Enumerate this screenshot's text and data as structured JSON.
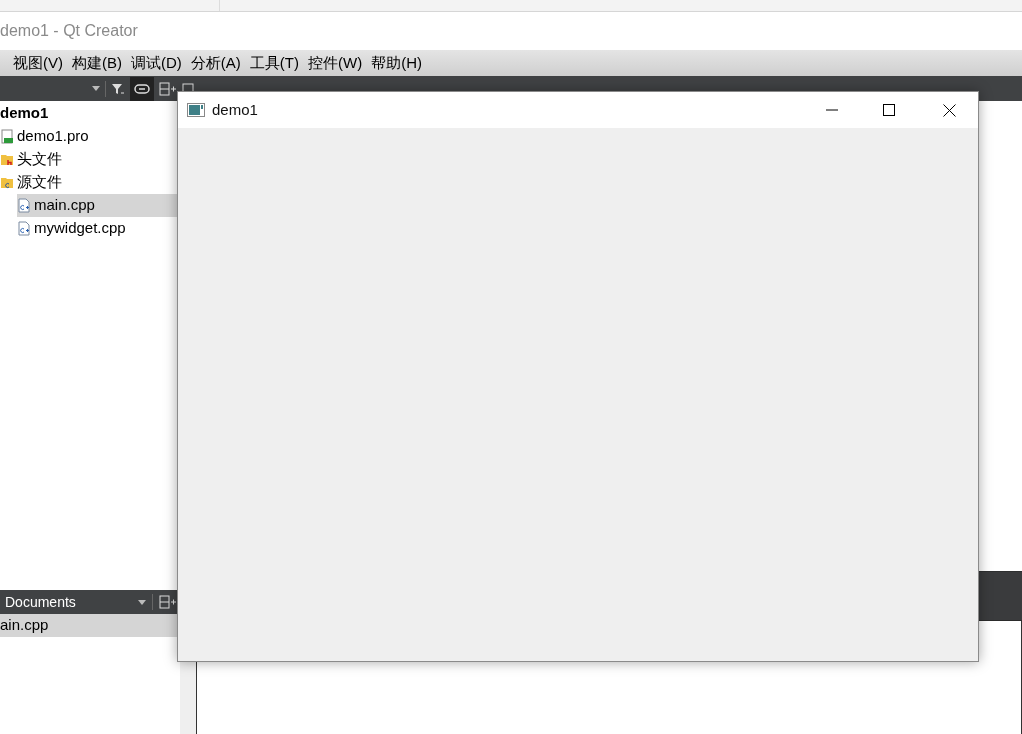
{
  "ide_window": {
    "title": "demo1 - Qt Creator"
  },
  "menu": [
    "视图(V)",
    "构建(B)",
    "调试(D)",
    "分析(A)",
    "工具(T)",
    "控件(W)",
    "帮助(H)"
  ],
  "project_tree": [
    {
      "label": "demo1",
      "kind": "project",
      "selected": false,
      "children": [
        {
          "label": "demo1.pro",
          "kind": "pro",
          "selected": false
        },
        {
          "label": "头文件",
          "kind": "headers",
          "selected": false
        },
        {
          "label": "源文件",
          "kind": "sources",
          "selected": false,
          "children": [
            {
              "label": "main.cpp",
              "kind": "cpp",
              "selected": true
            },
            {
              "label": "mywidget.cpp",
              "kind": "cpp",
              "selected": false
            }
          ]
        }
      ]
    }
  ],
  "open_documents": {
    "title": "Documents",
    "items": [
      {
        "label": "ain.cpp",
        "selected": true
      }
    ]
  },
  "app_window": {
    "title": "demo1"
  }
}
